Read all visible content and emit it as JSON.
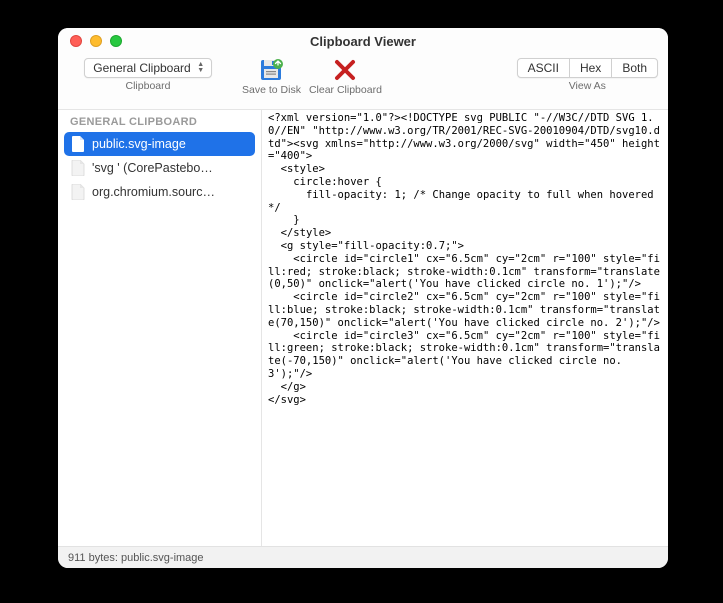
{
  "window": {
    "title": "Clipboard Viewer"
  },
  "toolbar": {
    "clipboard_selector": {
      "value": "General Clipboard",
      "label": "Clipboard"
    },
    "save": {
      "label": "Save to Disk"
    },
    "clear": {
      "label": "Clear Clipboard"
    },
    "view_as": {
      "label": "View As",
      "options": [
        "ASCII",
        "Hex",
        "Both"
      ]
    }
  },
  "sidebar": {
    "header": "GENERAL CLIPBOARD",
    "items": [
      {
        "label": "public.svg-image",
        "selected": true
      },
      {
        "label": "'svg ' (CorePastebo…",
        "selected": false
      },
      {
        "label": "org.chromium.sourc…",
        "selected": false
      }
    ]
  },
  "content": {
    "text": "<?xml version=\"1.0\"?><!DOCTYPE svg PUBLIC \"-//W3C//DTD SVG 1.0//EN\" \"http://www.w3.org/TR/2001/REC-SVG-20010904/DTD/svg10.dtd\"><svg xmlns=\"http://www.w3.org/2000/svg\" width=\"450\" height=\"400\">\n  <style>\n    circle:hover {\n      fill-opacity: 1; /* Change opacity to full when hovered */\n    }\n  </style>\n  <g style=\"fill-opacity:0.7;\">\n    <circle id=\"circle1\" cx=\"6.5cm\" cy=\"2cm\" r=\"100\" style=\"fill:red; stroke:black; stroke-width:0.1cm\" transform=\"translate(0,50)\" onclick=\"alert('You have clicked circle no. 1');\"/>\n    <circle id=\"circle2\" cx=\"6.5cm\" cy=\"2cm\" r=\"100\" style=\"fill:blue; stroke:black; stroke-width:0.1cm\" transform=\"translate(70,150)\" onclick=\"alert('You have clicked circle no. 2');\"/>\n    <circle id=\"circle3\" cx=\"6.5cm\" cy=\"2cm\" r=\"100\" style=\"fill:green; stroke:black; stroke-width:0.1cm\" transform=\"translate(-70,150)\" onclick=\"alert('You have clicked circle no. 3');\"/>\n  </g>\n</svg>"
  },
  "status": {
    "text": "911 bytes: public.svg-image"
  }
}
